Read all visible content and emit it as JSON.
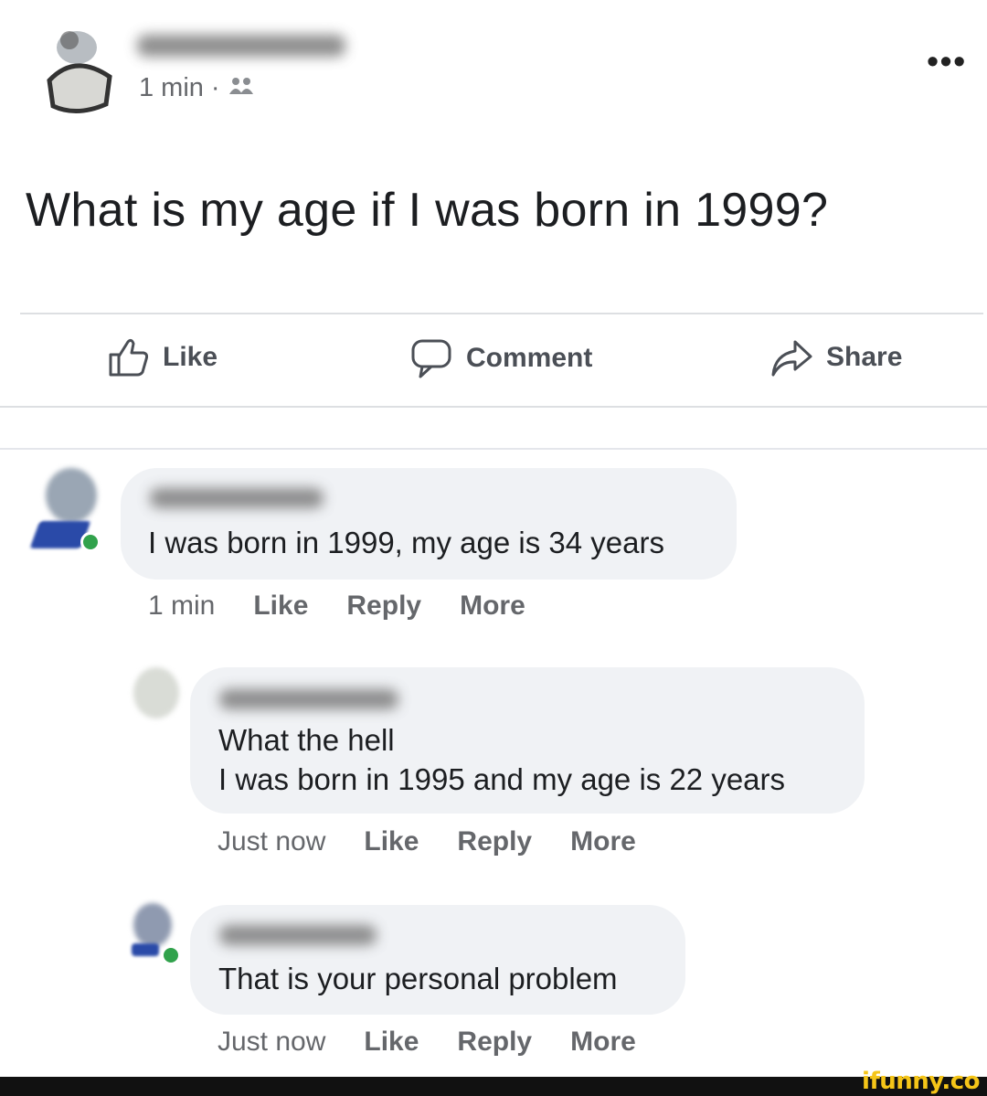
{
  "post": {
    "time": "1 min",
    "separator": "·",
    "audience_icon": "friends-icon",
    "text": "What is my age if I was born in 1999?"
  },
  "actions": {
    "like": "Like",
    "comment": "Comment",
    "share": "Share"
  },
  "comments": [
    {
      "text": "I was born in 1999, my age is 34 years",
      "time": "1 min",
      "like": "Like",
      "reply": "Reply",
      "more": "More"
    },
    {
      "text_line1": "What the hell",
      "text_line2": "I was born in 1995 and my age is 22 years",
      "time": "Just now",
      "like": "Like",
      "reply": "Reply",
      "more": "More"
    },
    {
      "text": "That is your personal problem",
      "time": "Just now",
      "like": "Like",
      "reply": "Reply",
      "more": "More"
    }
  ],
  "watermark": "ifunny.co",
  "colors": {
    "bubble": "#f0f2f5",
    "secondary_text": "#65676b",
    "online": "#31a24c",
    "watermark": "#f5c518"
  }
}
